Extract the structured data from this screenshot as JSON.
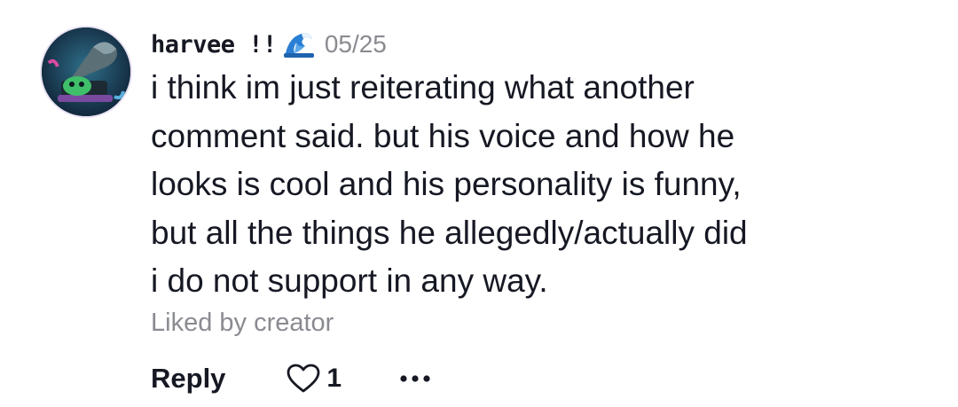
{
  "comment": {
    "username": "harvee !!",
    "badge_icon": "wave-icon",
    "date": "05/25",
    "text_lines": [
      "i think im just reiterating what another",
      "comment said. but his voice and how he",
      "looks is cool and his personality is funny,",
      "but all the things he allegedly/actually did",
      "i do not support in any way."
    ],
    "liked_by_label": "Liked by creator",
    "reply_label": "Reply",
    "like_count": "1",
    "more_icon": "more-options-icon"
  },
  "colors": {
    "text": "#161823",
    "muted": "#8a8b91",
    "background": "#ffffff"
  }
}
